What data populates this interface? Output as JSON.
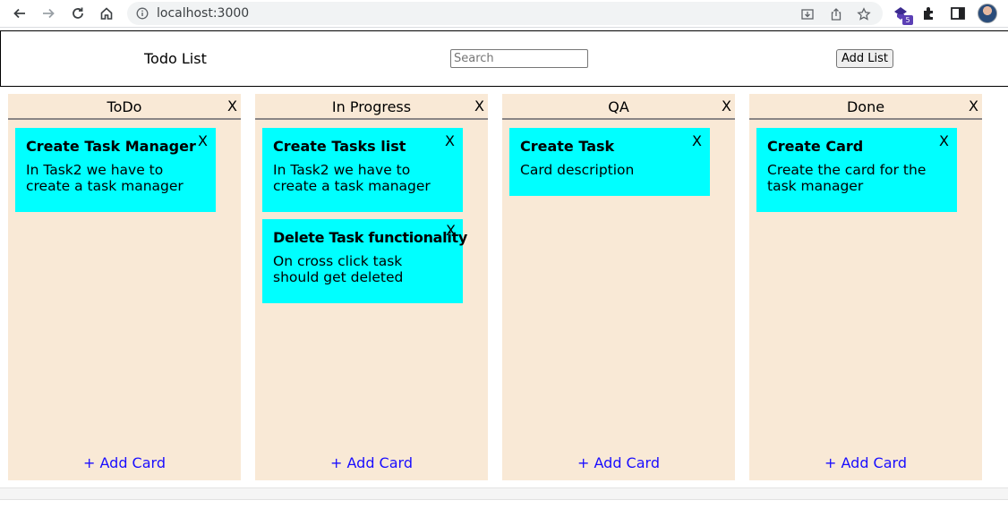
{
  "browser": {
    "url": "localhost:3000",
    "extension_badge": "5"
  },
  "header": {
    "title": "Todo List",
    "search_placeholder": "Search",
    "add_list_label": "Add List"
  },
  "columns": [
    {
      "title": "ToDo",
      "close": "X",
      "add_card": "+ Add Card",
      "cards": [
        {
          "title": "Create Task Manager",
          "description": "In Task2 we have to create a task manager",
          "close": "X"
        }
      ]
    },
    {
      "title": "In Progress",
      "close": "X",
      "add_card": "+ Add Card",
      "cards": [
        {
          "title": "Create Tasks list",
          "description": "In Task2 we have to create a task manager",
          "close": "X"
        },
        {
          "title": "Delete Task functionality",
          "description": "On cross click task should get deleted",
          "close": "X"
        }
      ]
    },
    {
      "title": "QA",
      "close": "X",
      "add_card": "+ Add Card",
      "cards": [
        {
          "title": "Create Task",
          "description": "Card description",
          "close": "X"
        }
      ]
    },
    {
      "title": "Done",
      "close": "X",
      "add_card": "+ Add Card",
      "cards": [
        {
          "title": "Create Card",
          "description": "Create the card for the task manager",
          "close": "X"
        }
      ]
    }
  ],
  "colors": {
    "column_bg": "#f9e9d6",
    "card_bg": "#00ffff",
    "link": "#1a0dff"
  },
  "icons": [
    "back-icon",
    "forward-icon",
    "reload-icon",
    "home-icon",
    "info-icon",
    "install-icon",
    "share-icon",
    "star-icon",
    "extension-icon",
    "puzzle-icon",
    "sidepanel-icon",
    "profile-avatar"
  ]
}
